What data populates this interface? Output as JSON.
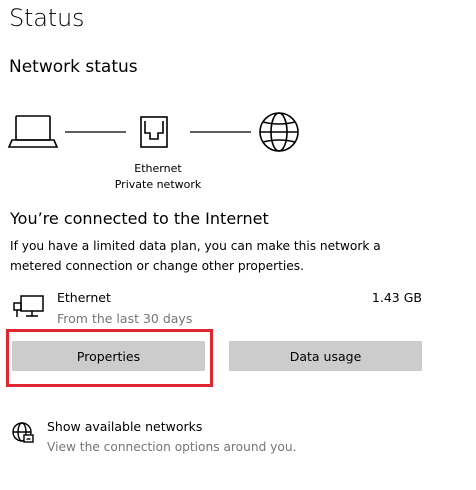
{
  "page_title": "Status",
  "section_title": "Network status",
  "diagram": {
    "adapter_name": "Ethernet",
    "network_type": "Private network",
    "icons": [
      "laptop-icon",
      "ethernet-port-icon",
      "globe-icon"
    ]
  },
  "connection": {
    "heading": "You’re connected to the Internet",
    "description": "If you have a limited data plan, you can make this network a metered connection or change other properties."
  },
  "adapter": {
    "icon": "ethernet-adapter-icon",
    "name": "Ethernet",
    "subtitle": "From the last 30 days",
    "data_used": "1.43 GB"
  },
  "buttons": {
    "properties": "Properties",
    "data_usage": "Data usage"
  },
  "highlight": {
    "color": "#e0262f",
    "target": "Properties"
  },
  "show_networks": {
    "icon": "globe-network-icon",
    "label": "Show available networks",
    "description": "View the connection options around you."
  },
  "colors": {
    "button_bg": "#cccccc",
    "secondary_text": "#767676"
  }
}
